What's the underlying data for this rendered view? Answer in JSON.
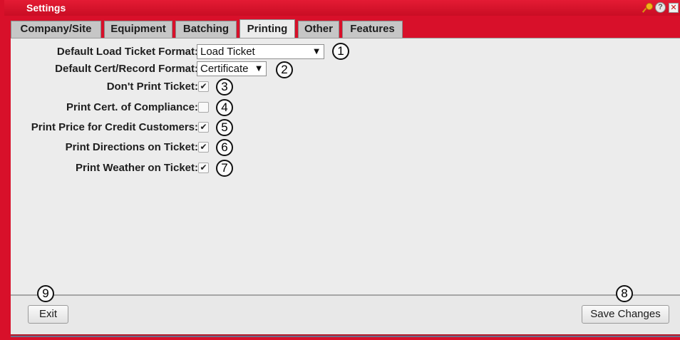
{
  "window": {
    "title": "Settings"
  },
  "tabs": [
    {
      "label": "Company/Site",
      "active": false
    },
    {
      "label": "Equipment",
      "active": false
    },
    {
      "label": "Batching",
      "active": false
    },
    {
      "label": "Printing",
      "active": true
    },
    {
      "label": "Other",
      "active": false
    },
    {
      "label": "Features",
      "active": false
    }
  ],
  "settings": {
    "load_ticket_format": {
      "label": "Default Load Ticket Format:",
      "value": "Load Ticket"
    },
    "cert_record_format": {
      "label": "Default Cert/Record Format:",
      "value": "Certificate"
    },
    "dont_print_ticket": {
      "label": "Don't Print Ticket:",
      "checked": true
    },
    "print_cert_compliance": {
      "label": "Print Cert. of Compliance:",
      "checked": false
    },
    "print_price_credit": {
      "label": "Print Price for Credit Customers:",
      "checked": true
    },
    "print_directions": {
      "label": "Print Directions on Ticket:",
      "checked": true
    },
    "print_weather": {
      "label": "Print Weather on Ticket:",
      "checked": true
    }
  },
  "callouts": [
    "1",
    "2",
    "3",
    "4",
    "5",
    "6",
    "7",
    "8",
    "9"
  ],
  "footer": {
    "exit_label": "Exit",
    "save_label": "Save Changes"
  },
  "icons": {
    "pin": "pin-icon",
    "help": "help-icon",
    "close": "close-icon",
    "dropdown": "dropdown-arrow-icon",
    "check": "checkmark-icon"
  },
  "colors": {
    "frame": "#d8102a",
    "panel": "#ececec",
    "tab": "#c6c6c6"
  }
}
